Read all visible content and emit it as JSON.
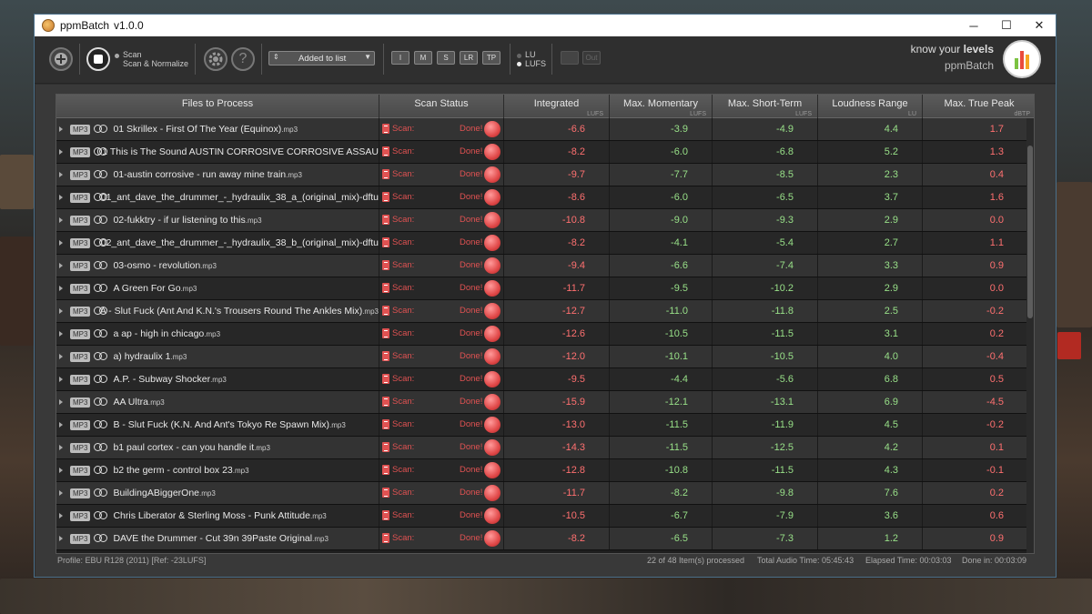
{
  "window": {
    "title": "ppmBatch",
    "version": "v1.0.0",
    "controls": [
      "─",
      "☐",
      "✕"
    ]
  },
  "toolbar": {
    "mode_scan": "Scan",
    "mode_scan_normalize": "Scan & Normalize",
    "sort_select": "Added to list",
    "metric_buttons": [
      "I",
      "M",
      "S",
      "LR",
      "TP"
    ],
    "unit_lu": "LU",
    "unit_lufs": "LUFS",
    "out_label": "Out",
    "brand_tagline_prefix": "know your ",
    "brand_tagline_bold": "levels",
    "brand_name": "ppmBatch"
  },
  "table": {
    "columns": [
      {
        "label": "Files to Process",
        "unit": ""
      },
      {
        "label": "Scan Status",
        "unit": ""
      },
      {
        "label": "Integrated",
        "unit": "LUFS"
      },
      {
        "label": "Max. Momentary",
        "unit": "LUFS"
      },
      {
        "label": "Max. Short-Term",
        "unit": "LUFS"
      },
      {
        "label": "Loudness Range",
        "unit": "LU"
      },
      {
        "label": "Max. True Peak",
        "unit": "dBTP"
      }
    ],
    "format_badge": "MP3",
    "scan_label": "Scan:",
    "done_label": "Done!",
    "rows": [
      {
        "name": "01 Skrillex - First Of The Year (Equinox)",
        "ext": ".mp3",
        "i": "-6.6",
        "m": "-3.9",
        "s": "-4.9",
        "lr": "4.4",
        "tp": "1.7"
      },
      {
        "name": "01 This is The Sound AUSTIN CORROSIVE CORROSIVE ASSAULT UN",
        "ext": "",
        "i": "-8.2",
        "m": "-6.0",
        "s": "-6.8",
        "lr": "5.2",
        "tp": "1.3"
      },
      {
        "name": "01-austin corrosive - run away mine train",
        "ext": ".mp3",
        "i": "-9.7",
        "m": "-7.7",
        "s": "-8.5",
        "lr": "2.3",
        "tp": "0.4"
      },
      {
        "name": "01_ant_dave_the_drummer_-_hydraulix_38_a_(original_mix)-dftu",
        "ext": "",
        "i": "-8.6",
        "m": "-6.0",
        "s": "-6.5",
        "lr": "3.7",
        "tp": "1.6"
      },
      {
        "name": "02-fukktry - if ur listening to this",
        "ext": ".mp3",
        "i": "-10.8",
        "m": "-9.0",
        "s": "-9.3",
        "lr": "2.9",
        "tp": "0.0"
      },
      {
        "name": "02_ant_dave_the_drummer_-_hydraulix_38_b_(original_mix)-dftu",
        "ext": "",
        "i": "-8.2",
        "m": "-4.1",
        "s": "-5.4",
        "lr": "2.7",
        "tp": "1.1"
      },
      {
        "name": "03-osmo - revolution",
        "ext": ".mp3",
        "i": "-9.4",
        "m": "-6.6",
        "s": "-7.4",
        "lr": "3.3",
        "tp": "0.9"
      },
      {
        "name": "A   Green For Go",
        "ext": ".mp3",
        "i": "-11.7",
        "m": "-9.5",
        "s": "-10.2",
        "lr": "2.9",
        "tp": "0.0"
      },
      {
        "name": "A - Slut Fuck (Ant And K.N.'s Trousers Round The Ankles Mix)",
        "ext": ".mp3",
        "i": "-12.7",
        "m": "-11.0",
        "s": "-11.8",
        "lr": "2.5",
        "tp": "-0.2"
      },
      {
        "name": "a ap - high in chicago",
        "ext": ".mp3",
        "i": "-12.6",
        "m": "-10.5",
        "s": "-11.5",
        "lr": "3.1",
        "tp": "0.2"
      },
      {
        "name": "a) hydraulix 1",
        "ext": ".mp3",
        "i": "-12.0",
        "m": "-10.1",
        "s": "-10.5",
        "lr": "4.0",
        "tp": "-0.4"
      },
      {
        "name": "A.P. - Subway Shocker",
        "ext": ".mp3",
        "i": "-9.5",
        "m": "-4.4",
        "s": "-5.6",
        "lr": "6.8",
        "tp": "0.5"
      },
      {
        "name": "AA   Ultra",
        "ext": ".mp3",
        "i": "-15.9",
        "m": "-12.1",
        "s": "-13.1",
        "lr": "6.9",
        "tp": "-4.5"
      },
      {
        "name": "B - Slut Fuck (K.N. And Ant's Tokyo Re Spawn Mix)",
        "ext": ".mp3",
        "i": "-13.0",
        "m": "-11.5",
        "s": "-11.9",
        "lr": "4.5",
        "tp": "-0.2"
      },
      {
        "name": "b1 paul cortex - can you handle it",
        "ext": ".mp3",
        "i": "-14.3",
        "m": "-11.5",
        "s": "-12.5",
        "lr": "4.2",
        "tp": "0.1"
      },
      {
        "name": "b2 the germ - control box 23",
        "ext": ".mp3",
        "i": "-12.8",
        "m": "-10.8",
        "s": "-11.5",
        "lr": "4.3",
        "tp": "-0.1"
      },
      {
        "name": "BuildingABiggerOne",
        "ext": ".mp3",
        "i": "-11.7",
        "m": "-8.2",
        "s": "-9.8",
        "lr": "7.6",
        "tp": "0.2"
      },
      {
        "name": "Chris Liberator & Sterling Moss - Punk Attitude",
        "ext": ".mp3",
        "i": "-10.5",
        "m": "-6.7",
        "s": "-7.9",
        "lr": "3.6",
        "tp": "0.6"
      },
      {
        "name": "DAVE the Drummer - Cut 39n 39Paste Original",
        "ext": ".mp3",
        "i": "-8.2",
        "m": "-6.5",
        "s": "-7.3",
        "lr": "1.2",
        "tp": "0.9"
      }
    ]
  },
  "status": {
    "profile": "Profile: EBU R128 (2011) [Ref: -23LUFS]",
    "processed": "22 of 48 Item(s) processed",
    "total_time": "Total Audio Time: 05:45:43",
    "elapsed": "Elapsed Time: 00:03:03",
    "done_in": "Done in: 00:03:09"
  }
}
